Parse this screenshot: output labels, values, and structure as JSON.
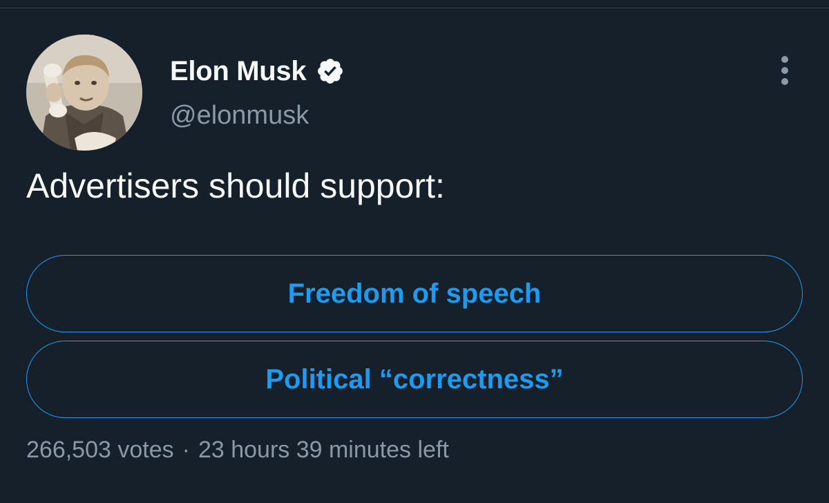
{
  "author": {
    "display_name": "Elon Musk",
    "handle": "@elonmusk",
    "verified": true,
    "avatar": "child-with-telephone-photo"
  },
  "icons": {
    "verified": "verified-badge-icon",
    "more": "more-vertical-icon"
  },
  "tweet": {
    "text": "Advertisers should support:"
  },
  "poll": {
    "options": [
      {
        "label": "Freedom of speech"
      },
      {
        "label": "Political “correctness”"
      }
    ],
    "votes": "266,503 votes",
    "separator": "·",
    "time_left": "23 hours 39 minutes left"
  },
  "colors": {
    "background": "#15202b",
    "text": "#f7f9f9",
    "secondary_text": "#8b98a5",
    "accent": "#1d9bf0",
    "divider": "#38444d"
  }
}
